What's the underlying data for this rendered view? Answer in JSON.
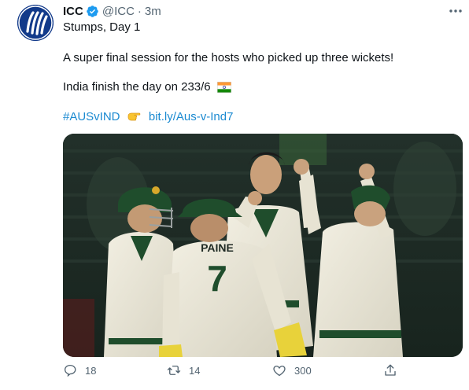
{
  "tweet": {
    "author_name": "ICC",
    "author_handle": "@ICC",
    "separator": "·",
    "time": "3m",
    "lines": {
      "title": "Stumps, Day 1",
      "body1": "A super final session for the hosts who picked up three wickets!",
      "body2": "India finish the day on 233/6"
    },
    "hashtag": "#AUSvIND",
    "link": "bit.ly/Aus-v-Ind7",
    "image": {
      "jersey_name": "PAINE",
      "jersey_number": "7"
    }
  },
  "actions": {
    "replies": "18",
    "retweets": "14",
    "likes": "300"
  },
  "colors": {
    "link": "#1b8ad1",
    "verified": "#1d9bf0",
    "muted": "#536471",
    "avatar_bg": "#123a8a"
  },
  "icons": {
    "verified": "verified-badge-icon",
    "more": "more-options-icon",
    "reply": "reply-icon",
    "retweet": "retweet-icon",
    "like": "heart-icon",
    "share": "share-icon",
    "flag": "india-flag-emoji",
    "pointing": "backhand-index-pointing-right-emoji"
  }
}
